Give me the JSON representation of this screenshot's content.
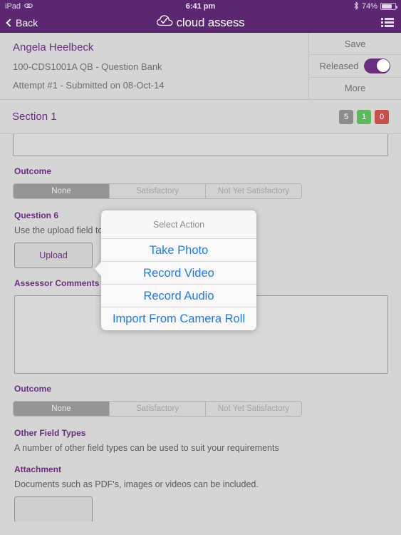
{
  "statusbar": {
    "device": "iPad",
    "device_icon": "link-icon",
    "time": "6:41 pm",
    "bluetooth_icon": "bluetooth-icon",
    "battery_percent": "74%",
    "battery_icon": "battery-icon"
  },
  "navbar": {
    "back_label": "Back",
    "back_icon": "chevron-left-icon",
    "brand": "cloud assess",
    "brand_icon": "cloud-check-logo",
    "menu_icon": "list-icon"
  },
  "header": {
    "name": "Angela Heelbeck",
    "course": "100-CDS1001A QB - Question Bank",
    "attempt": "Attempt #1 - Submitted on 08-Oct-14",
    "actions": {
      "save_label": "Save",
      "released_label": "Released",
      "released_on": true,
      "more_label": "More"
    }
  },
  "section": {
    "title": "Section 1",
    "badges": [
      {
        "value": "5",
        "color": "#8c8c8c",
        "name": "count-total"
      },
      {
        "value": "1",
        "color": "#5cb85c",
        "name": "count-satisfactory"
      },
      {
        "value": "0",
        "color": "#c9504a",
        "name": "count-not-yet-satisfactory"
      }
    ]
  },
  "outcome_options": [
    "None",
    "Satisfactory",
    "Not Yet Satisfactory"
  ],
  "content": {
    "outcome_label_1": "Outcome",
    "outcome_selected_1": "None",
    "question_label": "Question 6",
    "question_text": "Use the upload field to up",
    "upload_button": "Upload",
    "assessor_comments_label": "Assessor Comments",
    "assessor_comments_value": "",
    "outcome_label_2": "Outcome",
    "outcome_selected_2": "None",
    "other_field_types_label": "Other Field Types",
    "other_field_types_text": "A number of other field types can be used to suit your requirements",
    "attachment_label": "Attachment",
    "attachment_text": "Documents such as PDF's, images or videos can be included."
  },
  "popover": {
    "title": "Select Action",
    "items": [
      "Take Photo",
      "Record Video",
      "Record Audio",
      "Import From Camera Roll"
    ]
  },
  "colors": {
    "brand_purple": "#5c2771",
    "label_purple": "#6b2d80",
    "page_bg": "#d5d5d5",
    "link_blue": "#1a7bec"
  }
}
